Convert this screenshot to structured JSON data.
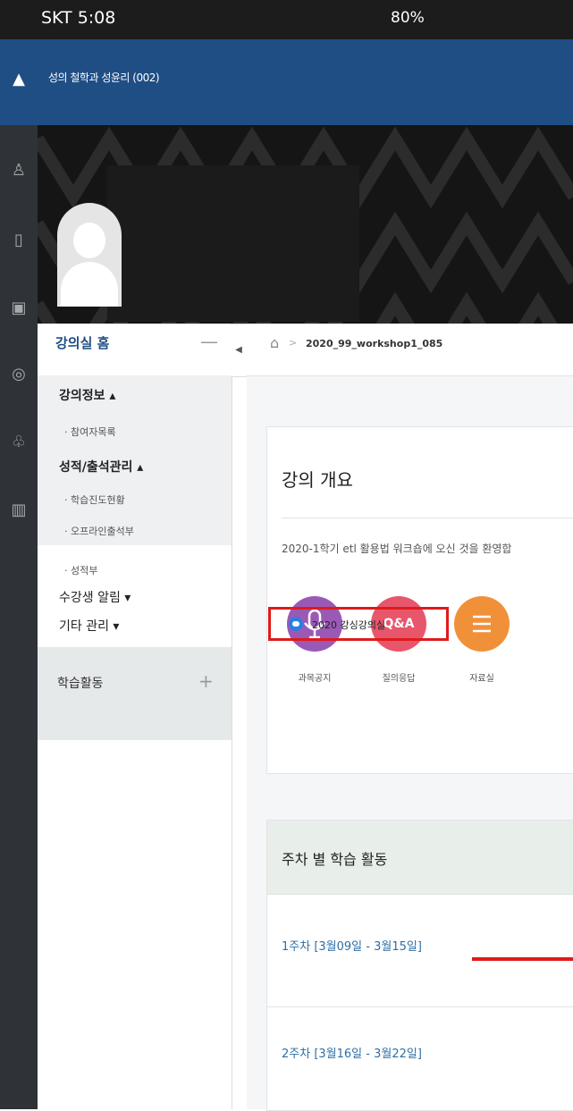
{
  "status_bar": {
    "left": "SKT 5:08",
    "right": "80%"
  },
  "header": {
    "title": "성의 철학과 성윤리 (002)"
  },
  "sidebar": {
    "home_label": "강의실 홈",
    "groups": [
      {
        "label": "강의정보 ▴",
        "items": [
          "· 참여자목록"
        ]
      },
      {
        "label": "성적/출석관리 ▴",
        "items": [
          "· 학습진도현황",
          "· 오프라인출석부",
          "· 성적부"
        ]
      }
    ],
    "notify_label": "수강생 알림 ▾",
    "etc_label": "기타 관리 ▾",
    "activity_label": "학습활동"
  },
  "breadcrumb": {
    "course_code": "2020_99_workshop1_085"
  },
  "overview": {
    "title": "강의 개요",
    "intro": "2020-1학기 etl 활용법 워크숍에 오신 것을 환영합",
    "icons": [
      {
        "name": "mic-icon",
        "label": "과목공지",
        "color": "#9b59b6"
      },
      {
        "name": "qa-icon",
        "label": "질의응답",
        "text": "Q&A",
        "color": "#e8566c"
      },
      {
        "name": "list-icon",
        "label": "자료실",
        "color": "#f0913a"
      }
    ]
  },
  "weekly": {
    "title": "주차 별 학습 활동",
    "weeks": [
      {
        "label": "1주차 [3월09일 - 3월15일]",
        "activity": "2020 강싱강의실"
      },
      {
        "label": "2주차 [3월16일 - 3월22일]"
      }
    ]
  },
  "colors": {
    "primary": "#1f4e85",
    "highlight": "#e01a1a",
    "rail": "#2f3236"
  }
}
